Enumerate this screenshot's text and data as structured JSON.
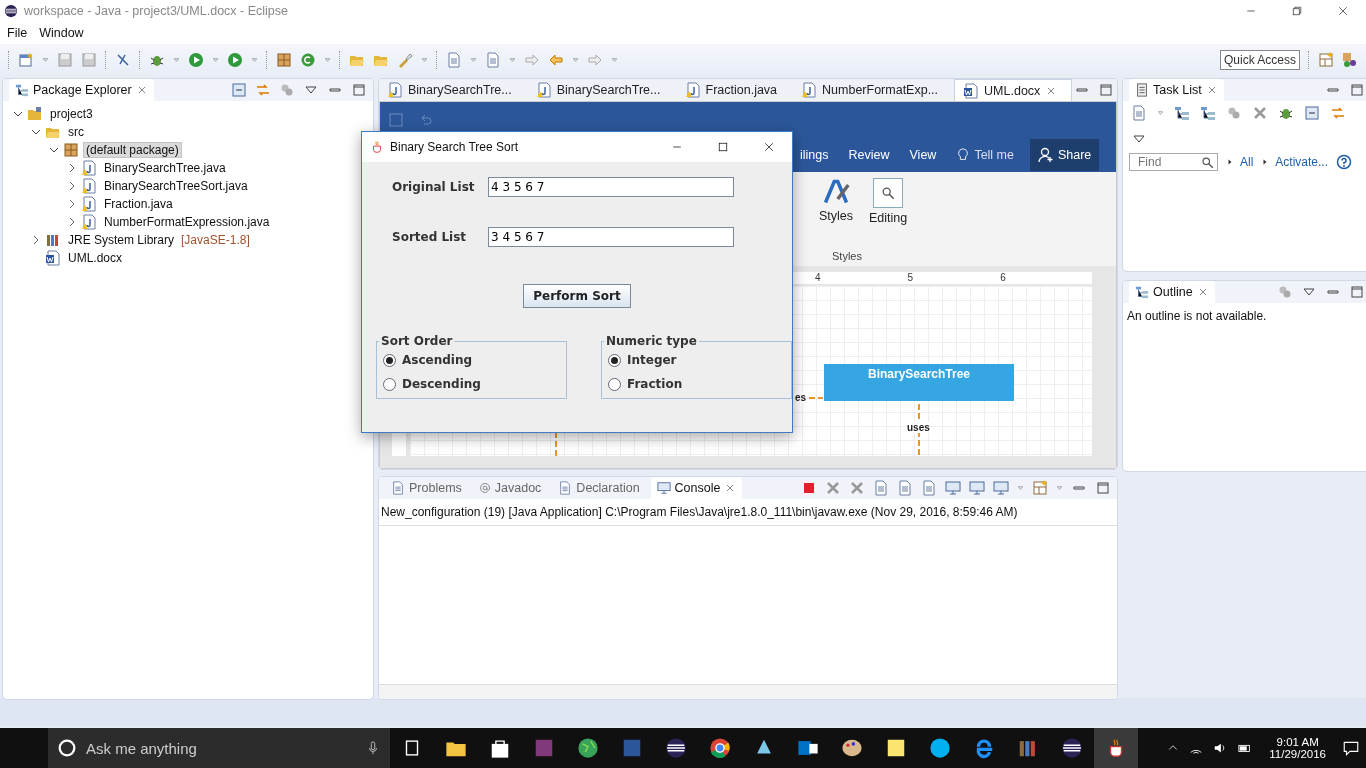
{
  "window": {
    "title": "workspace - Java - project3/UML.docx - Eclipse"
  },
  "menu": [
    "File",
    "Window"
  ],
  "quick_access": {
    "placeholder": "Quick Access"
  },
  "package_explorer": {
    "title": "Package Explorer",
    "tree": [
      {
        "label": "project3",
        "kind": "project",
        "expanded": true,
        "selected": false,
        "children": [
          {
            "label": "src",
            "kind": "folder",
            "expanded": true,
            "selected": false,
            "children": [
              {
                "label": "(default package)",
                "kind": "package",
                "expanded": true,
                "selected": true,
                "children": [
                  {
                    "label": "BinarySearchTree.java",
                    "kind": "java",
                    "expanded": false,
                    "selected": false
                  },
                  {
                    "label": "BinarySearchTreeSort.java",
                    "kind": "java",
                    "expanded": false,
                    "selected": false
                  },
                  {
                    "label": "Fraction.java",
                    "kind": "java",
                    "expanded": false,
                    "selected": false
                  },
                  {
                    "label": "NumberFormatExpression.java",
                    "kind": "java",
                    "expanded": false,
                    "selected": false
                  }
                ]
              }
            ]
          },
          {
            "label": "JRE System Library",
            "suffix": "[JavaSE-1.8]",
            "kind": "library",
            "expanded": false,
            "selected": false
          },
          {
            "label": "UML.docx",
            "kind": "doc",
            "selected": false
          }
        ]
      }
    ]
  },
  "editor_tabs": [
    {
      "label": "BinarySearchTre...",
      "kind": "java",
      "selected": false
    },
    {
      "label": "BinarySearchTre...",
      "kind": "java",
      "selected": false
    },
    {
      "label": "Fraction.java",
      "kind": "java",
      "selected": false
    },
    {
      "label": "NumberFormatExp...",
      "kind": "java",
      "selected": false
    },
    {
      "label": "UML.docx",
      "kind": "doc",
      "selected": true
    }
  ],
  "word": {
    "ribbon_tabs": [
      "ilings",
      "Review",
      "View"
    ],
    "tell_me": "Tell me",
    "share": "Share",
    "ribbon_buttons": [
      "Styles",
      "Editing"
    ],
    "group_label": "Styles",
    "ruler": [
      "4",
      "5",
      "6"
    ],
    "diagram": {
      "class_box": "BinarySearchTree",
      "left_label": "es",
      "down_label": "uses"
    }
  },
  "dialog": {
    "title": "Binary Search Tree Sort",
    "fields": [
      {
        "label": "Original List",
        "value": "4 3 5 6 7"
      },
      {
        "label": "Sorted List",
        "value": "3 4 5 6 7"
      }
    ],
    "button": "Perform Sort",
    "groups": [
      {
        "title": "Sort Order",
        "options": [
          {
            "label": "Ascending",
            "selected": true
          },
          {
            "label": "Descending",
            "selected": false
          }
        ]
      },
      {
        "title": "Numeric type",
        "options": [
          {
            "label": "Integer",
            "selected": true
          },
          {
            "label": "Fraction",
            "selected": false
          }
        ]
      }
    ]
  },
  "task_list": {
    "title": "Task List",
    "find": {
      "placeholder": "Find"
    },
    "links": [
      "All",
      "Activate..."
    ]
  },
  "outline": {
    "title": "Outline",
    "message": "An outline is not available."
  },
  "console_tabs": [
    {
      "label": "Problems",
      "selected": false
    },
    {
      "label": "Javadoc",
      "selected": false
    },
    {
      "label": "Declaration",
      "selected": false
    },
    {
      "label": "Console",
      "selected": true
    }
  ],
  "console": {
    "line": "New_configuration (19) [Java Application] C:\\Program Files\\Java\\jre1.8.0_111\\bin\\javaw.exe (Nov 29, 2016, 8:59:46 AM)"
  },
  "taskbar": {
    "search": {
      "placeholder": "Ask me anything"
    },
    "time": "9:01 AM",
    "date": "11/29/2016"
  }
}
